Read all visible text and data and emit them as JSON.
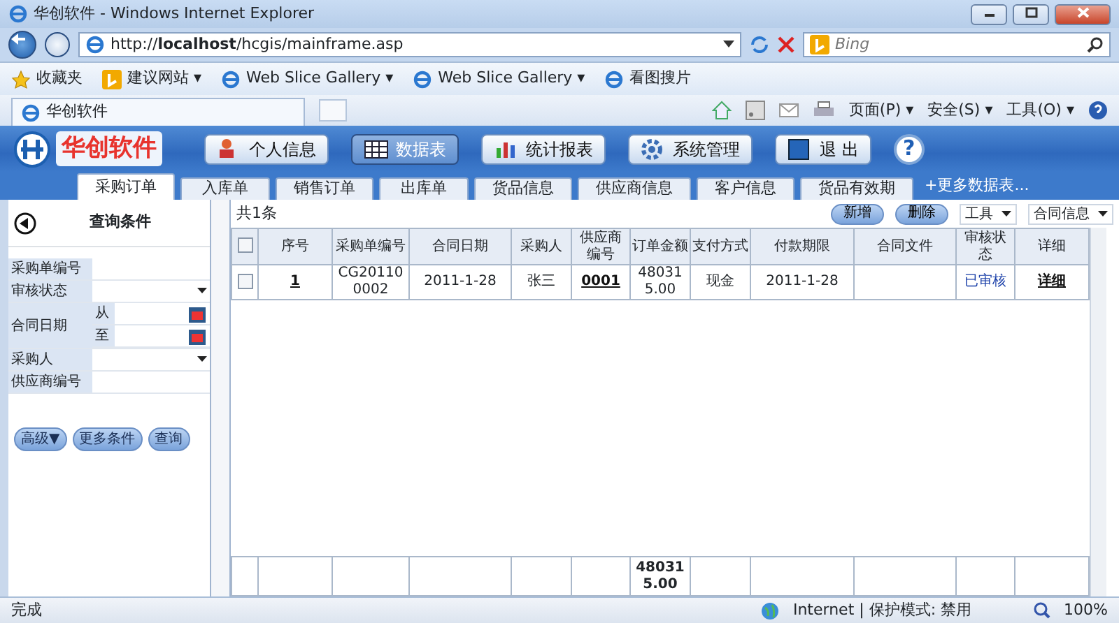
{
  "browser": {
    "title": "华创软件 - Windows Internet Explorer",
    "url_prefix": "http://",
    "url_host": "localhost",
    "url_path": "/hcgis/mainframe.asp",
    "search_placeholder": "Bing",
    "favorites": [
      {
        "label": "收藏夹",
        "kind": "star"
      },
      {
        "label": "建议网站 ▾",
        "kind": "bing"
      },
      {
        "label": "Web Slice Gallery ▾",
        "kind": "ie"
      },
      {
        "label": "Web Slice Gallery ▾",
        "kind": "ie"
      },
      {
        "label": "看图搜片",
        "kind": "ie"
      }
    ],
    "tab": "华创软件",
    "commands": [
      "页面(P) ▾",
      "安全(S) ▾",
      "工具(O) ▾"
    ]
  },
  "app": {
    "logo": "华创软件",
    "toolbar": [
      {
        "label": "个人信息",
        "selected": false
      },
      {
        "label": "数据表",
        "selected": true
      },
      {
        "label": "统计报表",
        "selected": false
      },
      {
        "label": "系统管理",
        "selected": false
      },
      {
        "label": "退 出",
        "selected": false
      }
    ],
    "help": "?",
    "tabs": [
      {
        "label": "采购订单",
        "selected": true
      },
      {
        "label": "入库单",
        "selected": false
      },
      {
        "label": "销售订单",
        "selected": false
      },
      {
        "label": "出库单",
        "selected": false
      },
      {
        "label": "货品信息",
        "selected": false
      },
      {
        "label": "供应商信息",
        "selected": false
      },
      {
        "label": "客户信息",
        "selected": false
      },
      {
        "label": "货品有效期",
        "selected": false
      }
    ],
    "more_tabs": "+更多数据表..."
  },
  "query": {
    "title": "查询条件",
    "fields": [
      {
        "label": "采购单编号",
        "kind": "text"
      },
      {
        "label": "审核状态",
        "kind": "select"
      },
      {
        "label": "合同日期",
        "kind": "daterange",
        "from": "从",
        "to": "至"
      },
      {
        "label": "采购人",
        "kind": "select"
      },
      {
        "label": "供应商编号",
        "kind": "text"
      }
    ],
    "buttons": [
      "高级▼",
      "更多条件",
      "查询"
    ]
  },
  "grid": {
    "count": "共1条",
    "actions": [
      "新增",
      "删除"
    ],
    "menus": [
      "工具",
      "合同信息"
    ],
    "columns": [
      "序号",
      "采购单编号",
      "合同日期",
      "采购人",
      "供应商编号",
      "订单金额",
      "支付方式",
      "付款期限",
      "合同文件",
      "审核状态",
      "详细"
    ],
    "rows": [
      {
        "checked": false,
        "cells": [
          {
            "text": "1",
            "kind": "link"
          },
          {
            "text": "CG201100002",
            "kind": "text"
          },
          {
            "text": "2011-1-28",
            "kind": "text"
          },
          {
            "text": "张三",
            "kind": "text"
          },
          {
            "text": "0001",
            "kind": "link"
          },
          {
            "text": "480315.00",
            "kind": "text"
          },
          {
            "text": "现金",
            "kind": "text"
          },
          {
            "text": "2011-1-28",
            "kind": "text"
          },
          {
            "kind": "blank"
          },
          {
            "text": "已审核",
            "kind": "status"
          },
          {
            "text": "详细",
            "kind": "link"
          }
        ]
      }
    ],
    "select_all_checked": false,
    "totals": [
      {
        "kind": "blank"
      },
      {
        "kind": "blank"
      },
      {
        "kind": "blank"
      },
      {
        "kind": "blank"
      },
      {
        "kind": "blank"
      },
      {
        "kind": "sum",
        "text": "480315.00"
      },
      {
        "kind": "blank"
      },
      {
        "kind": "blank"
      },
      {
        "kind": "blank"
      },
      {
        "kind": "blank"
      },
      {
        "kind": "blank"
      }
    ]
  },
  "status": {
    "text": "完成",
    "zone": "Internet | 保护模式: 禁用",
    "zoom": "100%"
  }
}
